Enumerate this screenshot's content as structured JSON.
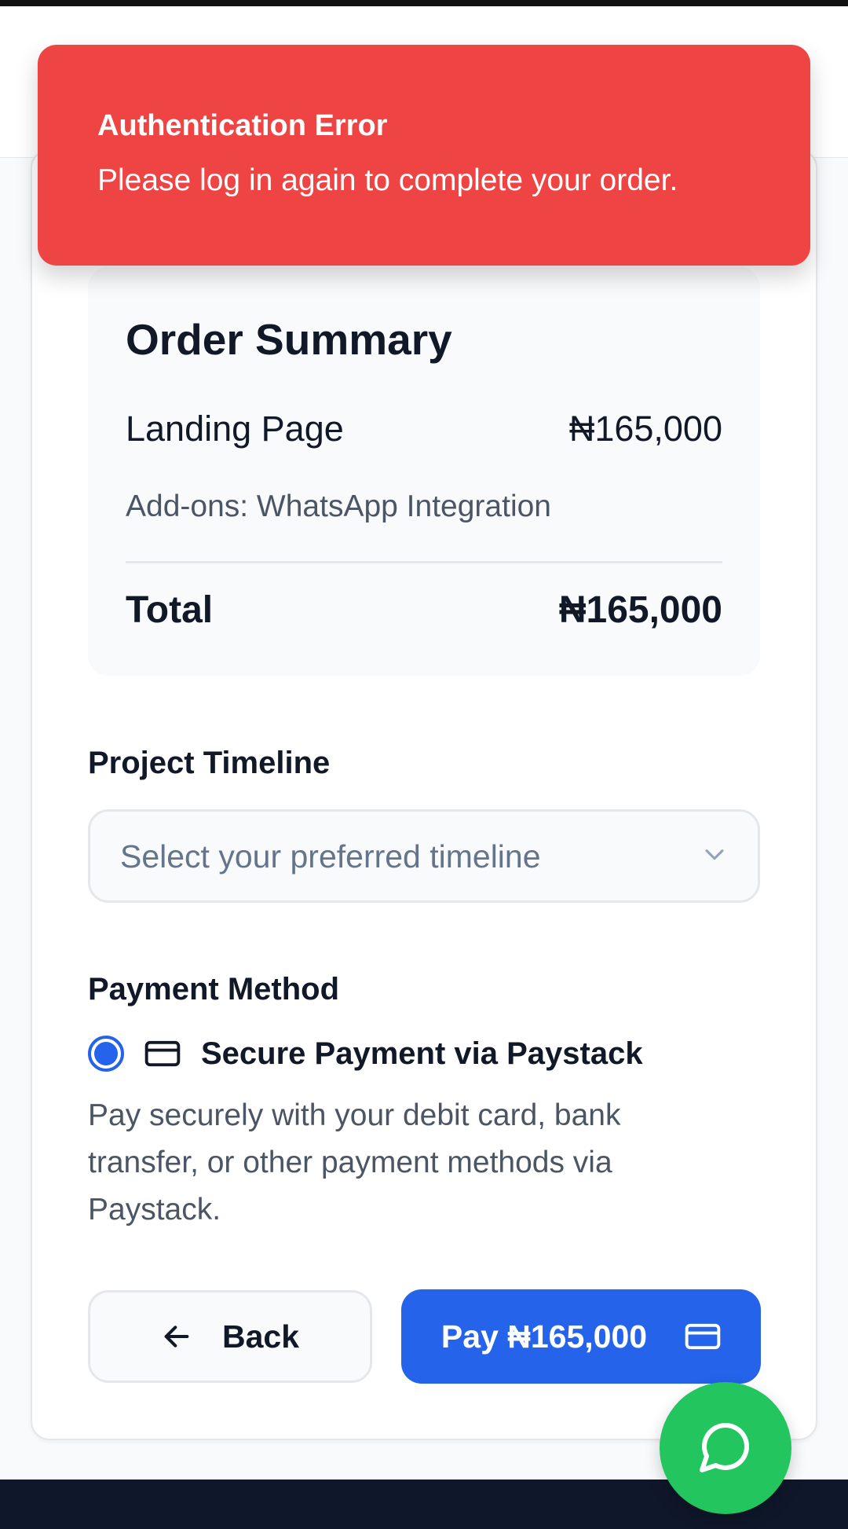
{
  "toast": {
    "title": "Authentication Error",
    "message": "Please log in again to complete your order.",
    "color": "#ef4444"
  },
  "order_summary": {
    "title": "Order Summary",
    "item_name": "Landing Page",
    "item_price": "₦165,000",
    "addons": "Add-ons: WhatsApp Integration",
    "total_label": "Total",
    "total_value": "₦165,000"
  },
  "timeline": {
    "label": "Project Timeline",
    "placeholder": "Select your preferred timeline",
    "icon": "chevron-down-icon"
  },
  "payment": {
    "label": "Payment Method",
    "option_label": "Secure Payment via Paystack",
    "option_selected": true,
    "option_icon": "credit-card-icon",
    "description": "Pay securely with your debit card, bank transfer, or other payment methods via Paystack."
  },
  "actions": {
    "back_label": "Back",
    "back_icon": "arrow-left-icon",
    "pay_label": "Pay ₦165,000",
    "pay_icon": "credit-card-icon",
    "pay_color": "#2563eb"
  },
  "fab": {
    "icon": "whatsapp-chat-icon",
    "color": "#22c55e"
  }
}
